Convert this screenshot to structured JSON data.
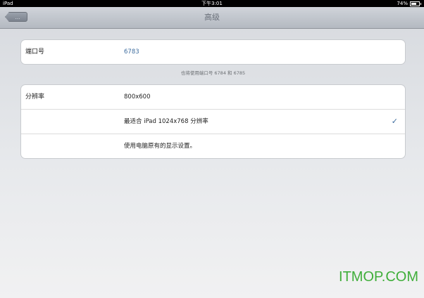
{
  "statusbar": {
    "device": "iPad",
    "time": "下午3:01",
    "battery_text": "74%",
    "battery_level": 0.74
  },
  "navbar": {
    "back_label": "…",
    "title": "高级"
  },
  "port": {
    "label": "端口号",
    "value": "6783",
    "note": "也将使用端口号 6784 和 6785"
  },
  "resolution": {
    "label": "分辨率",
    "options": [
      {
        "label": "800x600",
        "selected": false
      },
      {
        "label": "最适合 iPad 1024x768 分辨率",
        "selected": true
      },
      {
        "label": "使用电脑原有的显示设置。",
        "selected": false
      }
    ],
    "check_mark": "✓"
  },
  "watermark": "ITMOP.COM",
  "colors": {
    "accent": "#3d6c9e",
    "watermark": "#3fae3a"
  }
}
